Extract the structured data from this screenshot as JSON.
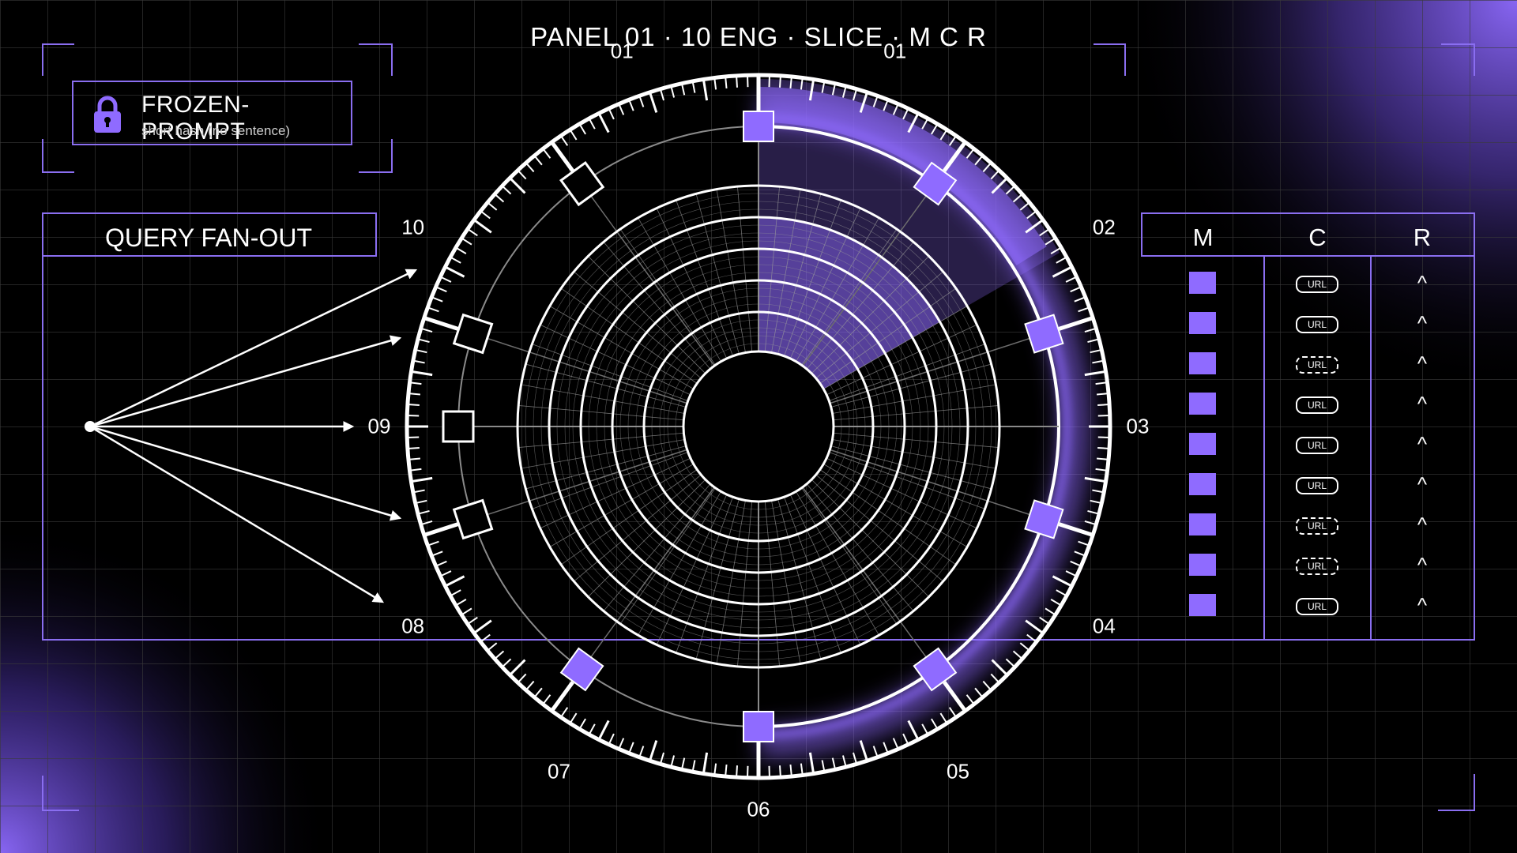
{
  "header": {
    "title": "PANEL 01 · 10 ENG · SLICE · M C R"
  },
  "lock_panel": {
    "icon": "padlock-icon",
    "title": "FROZEN-PROMPT",
    "subtitle": "short hash (no sentence)"
  },
  "fanout": {
    "title": "QUERY FAN-OUT",
    "arrow_count": 5
  },
  "dial": {
    "labels": [
      "01",
      "01",
      "02",
      "03",
      "04",
      "05",
      "06",
      "07",
      "08",
      "09",
      "10"
    ],
    "highlight_slice": "01-02"
  },
  "table": {
    "headers": {
      "m": "M",
      "c": "C",
      "r": "R"
    },
    "rows": [
      {
        "c": "URL",
        "c_style": "solid",
        "r": "^"
      },
      {
        "c": "URL",
        "c_style": "solid",
        "r": "^"
      },
      {
        "c": "URL",
        "c_style": "dashed",
        "r": "^"
      },
      {
        "c": "URL",
        "c_style": "solid",
        "r": "^"
      },
      {
        "c": "URL",
        "c_style": "solid",
        "r": "^"
      },
      {
        "c": "URL",
        "c_style": "solid",
        "r": "^"
      },
      {
        "c": "URL",
        "c_style": "dashed",
        "r": "^"
      },
      {
        "c": "URL",
        "c_style": "dashed",
        "r": "^"
      },
      {
        "c": "URL",
        "c_style": "solid",
        "r": "^"
      }
    ]
  },
  "colors": {
    "accent": "#7b5cf0",
    "accent_bright": "#8f6bff",
    "background": "#000000",
    "line": "#ffffff",
    "grid": "#3a3a3a"
  }
}
